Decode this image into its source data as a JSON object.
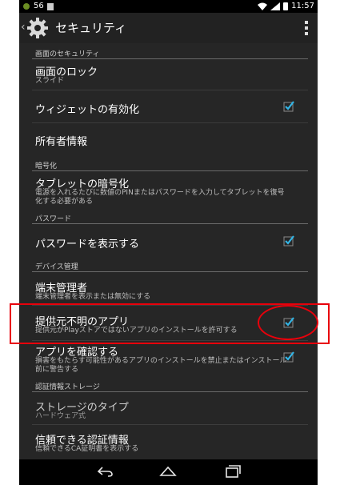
{
  "status": {
    "signal_label": "56",
    "time": "11:57"
  },
  "header": {
    "title": "セキュリティ"
  },
  "sections": {
    "screen_security": "画面のセキュリティ",
    "encryption": "暗号化",
    "password": "パスワード",
    "device_admin": "デバイス管理",
    "credential_storage": "認証情報ストレージ"
  },
  "items": {
    "screen_lock": {
      "title": "画面のロック",
      "subtitle": "スライド"
    },
    "widget_enable": {
      "title": "ウィジェットの有効化"
    },
    "owner_info": {
      "title": "所有者情報"
    },
    "encrypt_tablet": {
      "title": "タブレットの暗号化",
      "subtitle": "電源を入れるたびに数値のPINまたはパスワードを入力してタブレットを復号化する必要がある"
    },
    "show_password": {
      "title": "パスワードを表示する"
    },
    "device_administrator": {
      "title": "端末管理者",
      "subtitle": "端末管理者を表示または無効にする"
    },
    "unknown_sources": {
      "title": "提供元不明のアプリ",
      "subtitle": "提供元がPlayストアではないアプリのインストールを許可する"
    },
    "verify_apps": {
      "title": "アプリを確認する",
      "subtitle": "損害をもたらす可能性があるアプリのインストールを禁止またはインストール前に警告する"
    },
    "storage_type": {
      "title": "ストレージのタイプ",
      "subtitle": "ハードウェア式"
    },
    "trusted_credentials": {
      "title": "信頼できる認証情報",
      "subtitle": "信頼できるCA証明書を表示する"
    }
  },
  "colors": {
    "accent": "#33b5e5",
    "highlight": "#e8000b"
  }
}
